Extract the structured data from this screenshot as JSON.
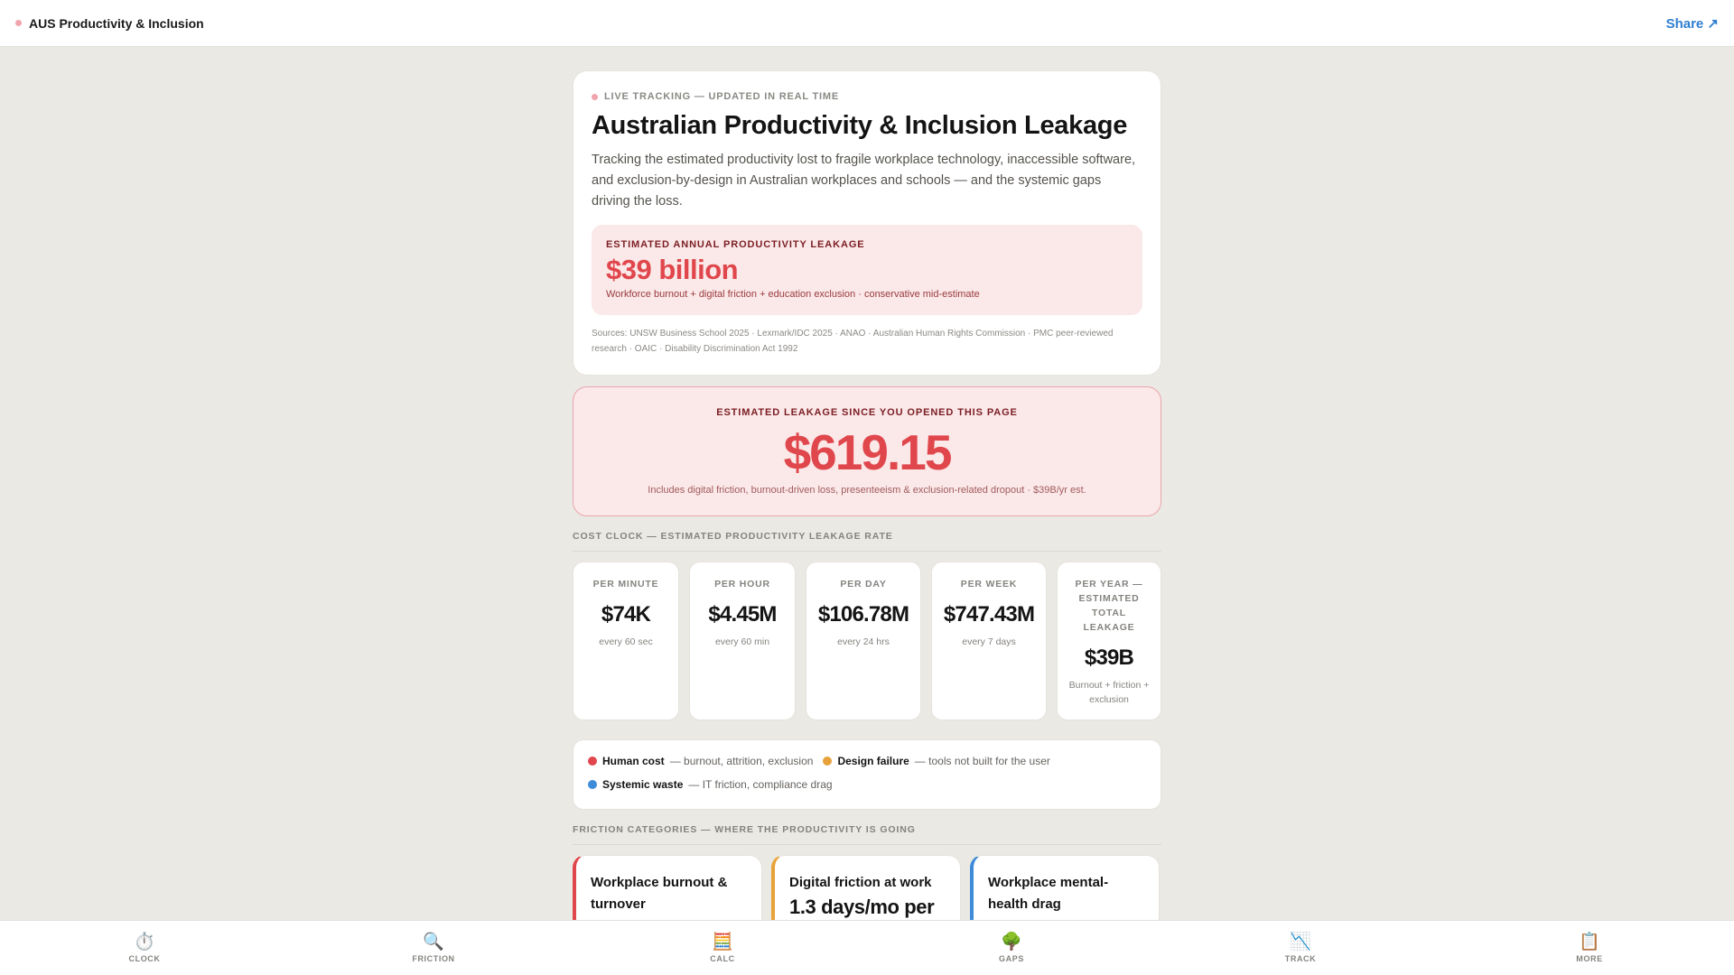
{
  "header": {
    "brand": "AUS Productivity & Inclusion",
    "share": "Share ↗"
  },
  "hero": {
    "live": "LIVE TRACKING — UPDATED IN REAL TIME",
    "title": "Australian Productivity & Inclusion Leakage",
    "description": "Tracking the estimated productivity lost to fragile workplace technology, inaccessible software, and exclusion-by-design in Australian workplaces and schools — and the systemic gaps driving the loss.",
    "annual_label": "ESTIMATED ANNUAL PRODUCTIVITY LEAKAGE",
    "annual_value": "$39 billion",
    "annual_sub": "Workforce burnout + digital friction + education exclusion · conservative mid-estimate",
    "sources": "Sources: UNSW Business School 2025 · Lexmark/IDC 2025 · ANAO · Australian Human Rights Commission · PMC peer-reviewed research · OAIC · Disability Discrimination Act 1992"
  },
  "since": {
    "label": "ESTIMATED LEAKAGE SINCE YOU OPENED THIS PAGE",
    "value": "$619.15",
    "sub": "Includes digital friction, burnout-driven loss, presenteeism & exclusion-related dropout · $39B/yr est."
  },
  "cost_clock": {
    "title": "COST CLOCK — ESTIMATED PRODUCTIVITY LEAKAGE RATE",
    "rates": [
      {
        "label": "PER MINUTE",
        "value": "$74K",
        "sub": "every 60 sec"
      },
      {
        "label": "PER HOUR",
        "value": "$4.45M",
        "sub": "every 60 min"
      },
      {
        "label": "PER DAY",
        "value": "$106.78M",
        "sub": "every 24 hrs"
      },
      {
        "label": "PER WEEK",
        "value": "$747.43M",
        "sub": "every 7 days"
      },
      {
        "label": "PER YEAR — ESTIMATED TOTAL LEAKAGE",
        "value": "$39B",
        "sub": "Burnout + friction + exclusion"
      }
    ]
  },
  "legend": [
    {
      "name": "Human cost",
      "desc": "— burnout, attrition, exclusion",
      "color": "#e0474c"
    },
    {
      "name": "Design failure",
      "desc": "— tools not built for the user",
      "color": "#e8a23a"
    },
    {
      "name": "Systemic waste",
      "desc": "— IT friction, compliance drag",
      "color": "#3d8bd9"
    }
  ],
  "friction": {
    "title": "FRICTION CATEGORIES — WHERE THE PRODUCTIVITY IS GOING",
    "cards": [
      {
        "title": "Workplace burnout & turnover",
        "big": "",
        "color": "#e0474c"
      },
      {
        "title": "Digital friction at work",
        "big": "1.3 days/mo per",
        "color": "#e8a23a"
      },
      {
        "title": "Workplace mental-health drag",
        "big": "",
        "color": "#3d8bd9"
      }
    ]
  },
  "nav": [
    {
      "icon": "⏱️",
      "label": "CLOCK"
    },
    {
      "icon": "🔍",
      "label": "FRICTION"
    },
    {
      "icon": "🧮",
      "label": "CALC"
    },
    {
      "icon": "🌳",
      "label": "GAPS"
    },
    {
      "icon": "📉",
      "label": "TRACK"
    },
    {
      "icon": "📋",
      "label": "MORE"
    }
  ]
}
